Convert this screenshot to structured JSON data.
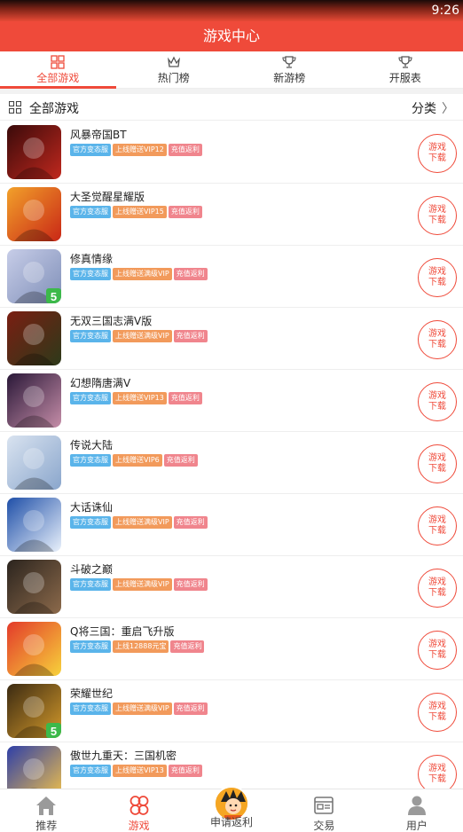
{
  "status": {
    "time": "9:26"
  },
  "header": {
    "title": "游戏中心"
  },
  "tabs": [
    {
      "label": "全部游戏",
      "icon": "grid-icon",
      "active": true
    },
    {
      "label": "热门榜",
      "icon": "crown-icon",
      "active": false
    },
    {
      "label": "新游榜",
      "icon": "trophy-icon",
      "active": false
    },
    {
      "label": "开服表",
      "icon": "trophy-icon",
      "active": false
    }
  ],
  "section": {
    "title": "全部游戏",
    "category_label": "分类"
  },
  "download_label": [
    "游戏",
    "下载"
  ],
  "games": [
    {
      "name": "风暴帝国BT",
      "tags": [
        "官方变态服",
        "上线赠送VIP12",
        "充值返利"
      ],
      "art_colors": [
        "#3a0a0a",
        "#c0281e"
      ]
    },
    {
      "name": "大圣觉醒星耀版",
      "tags": [
        "官方变态服",
        "上线赠送VIP15",
        "充值返利"
      ],
      "art_colors": [
        "#f2a12a",
        "#c92716"
      ]
    },
    {
      "name": "修真情缘",
      "tags": [
        "官方变态服",
        "上线赠送满级VIP",
        "充值返利"
      ],
      "art_colors": [
        "#c7cde8",
        "#7f8fb8"
      ],
      "badge": "5"
    },
    {
      "name": "无双三国志满V版",
      "tags": [
        "官方变态服",
        "上线赠送满级VIP",
        "充值返利"
      ],
      "art_colors": [
        "#7a1e12",
        "#2d3a1a"
      ]
    },
    {
      "name": "幻想隋唐满V",
      "tags": [
        "官方变态服",
        "上线赠送VIP13",
        "充值返利"
      ],
      "art_colors": [
        "#2a1838",
        "#c58da8"
      ]
    },
    {
      "name": "传说大陆",
      "tags": [
        "官方变态服",
        "上线赠送VIP6",
        "充值返利"
      ],
      "art_colors": [
        "#d9e3f0",
        "#8aa6cc"
      ]
    },
    {
      "name": "大话诛仙",
      "tags": [
        "官方变态服",
        "上线赠送满级VIP",
        "充值返利"
      ],
      "art_colors": [
        "#1f4fa8",
        "#e9f1fb"
      ]
    },
    {
      "name": "斗破之巅",
      "tags": [
        "官方变态服",
        "上线赠送满级VIP",
        "充值返利"
      ],
      "art_colors": [
        "#2b241e",
        "#8c6a4b"
      ]
    },
    {
      "name": "Q将三国：重启飞升版",
      "tags": [
        "官方变态服",
        "上线12888元宝",
        "充值返利"
      ],
      "art_colors": [
        "#e33a2a",
        "#f7d23b"
      ]
    },
    {
      "name": "荣耀世纪",
      "tags": [
        "官方变态服",
        "上线赠送满级VIP",
        "充值返利"
      ],
      "art_colors": [
        "#3b2a12",
        "#d49a2b"
      ],
      "badge": "5"
    },
    {
      "name": "傲世九重天：三国机密",
      "tags": [
        "官方变态服",
        "上线赠送VIP13",
        "充值返利"
      ],
      "art_colors": [
        "#2e3fa8",
        "#f2c24a"
      ]
    }
  ],
  "bottom_nav": [
    {
      "label": "推荐",
      "icon": "home-icon",
      "active": false
    },
    {
      "label": "游戏",
      "icon": "clover-icon",
      "active": true
    },
    {
      "label": "申请返利",
      "icon": "avatar-icon",
      "active": false
    },
    {
      "label": "交易",
      "icon": "trade-icon",
      "active": false
    },
    {
      "label": "用户",
      "icon": "user-icon",
      "active": false
    }
  ],
  "colors": {
    "accent": "#ef4a3a",
    "tag_blue": "#5ab4ea",
    "tag_orange": "#f29a5b",
    "tag_pink": "#f0858d"
  }
}
